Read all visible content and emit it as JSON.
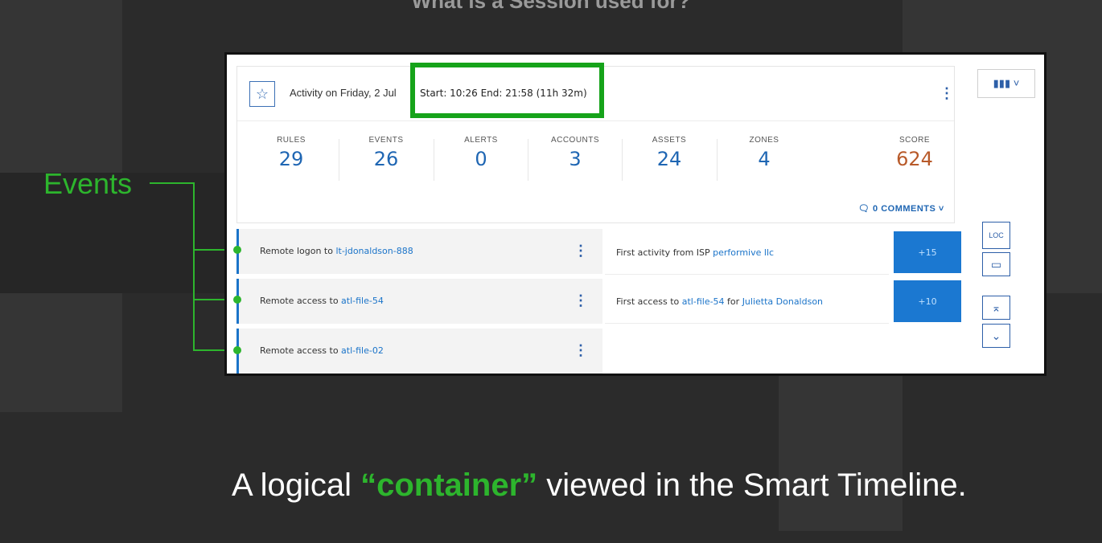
{
  "slide": {
    "title": "What is a Session used for?",
    "caption_before": "A logical ",
    "caption_highlight": "“container”",
    "caption_after": " viewed in the Smart Timeline.",
    "events_label": "Events"
  },
  "session": {
    "activity_title": "Activity on Friday, 2 Jul",
    "start_end": "Start: 10:26 End: 21:58 (11h 32m)",
    "stats": [
      {
        "label": "RULES",
        "value": "29"
      },
      {
        "label": "EVENTS",
        "value": "26"
      },
      {
        "label": "ALERTS",
        "value": "0"
      },
      {
        "label": "ACCOUNTS",
        "value": "3"
      },
      {
        "label": "ASSETS",
        "value": "24"
      },
      {
        "label": "ZONES",
        "value": "4"
      },
      {
        "label": "SCORE",
        "value": "624"
      }
    ],
    "comments_label": "0 COMMENTS ˅",
    "events": [
      {
        "prefix": "Remote logon to ",
        "link": "lt-jdonaldson-888"
      },
      {
        "prefix": "Remote access to ",
        "link": "atl-file-54"
      },
      {
        "prefix": "Remote access to ",
        "link": "atl-file-02"
      }
    ],
    "details": [
      {
        "prefix": "First activity from ISP ",
        "link1": "performive llc",
        "middle": "",
        "link2": "",
        "score": "+15"
      },
      {
        "prefix": "First access to ",
        "link1": "atl-file-54",
        "middle": " for ",
        "link2": "Julietta Donaldson",
        "score": "+10"
      }
    ]
  },
  "icons": {
    "star": "star-icon",
    "chart": "bar-chart-icon",
    "loc": "location-icon",
    "calendar": "calendar-icon",
    "collapse": "collapse-up-icon",
    "expand": "expand-down-icon",
    "comment": "comment-icon"
  },
  "colors": {
    "highlight_green": "#16a31a",
    "link_blue": "#1b74c9",
    "score_badge": "#1b78d1",
    "score_value": "#b85a2a"
  }
}
